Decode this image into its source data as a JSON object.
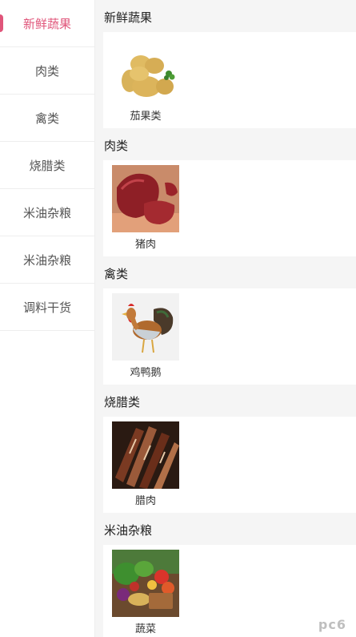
{
  "sidebar": {
    "items": [
      {
        "label": "新鲜蔬果",
        "active": true
      },
      {
        "label": "肉类"
      },
      {
        "label": "禽类"
      },
      {
        "label": "烧腊类"
      },
      {
        "label": "米油杂粮"
      },
      {
        "label": "米油杂粮"
      },
      {
        "label": "调料干货"
      }
    ],
    "accent_color": "#e0557a"
  },
  "sections": [
    {
      "title": "新鲜蔬果",
      "product": {
        "label": "茄果类",
        "image": "potato-image"
      }
    },
    {
      "title": "肉类",
      "product": {
        "label": "猪肉",
        "image": "pork-image"
      }
    },
    {
      "title": "禽类",
      "product": {
        "label": "鸡鸭鹅",
        "image": "rooster-image"
      }
    },
    {
      "title": "烧腊类",
      "product": {
        "label": "腊肉",
        "image": "cured-meat-image"
      }
    },
    {
      "title": "米油杂粮",
      "product": {
        "label": "蔬菜",
        "image": "vegetables-image"
      }
    }
  ]
}
